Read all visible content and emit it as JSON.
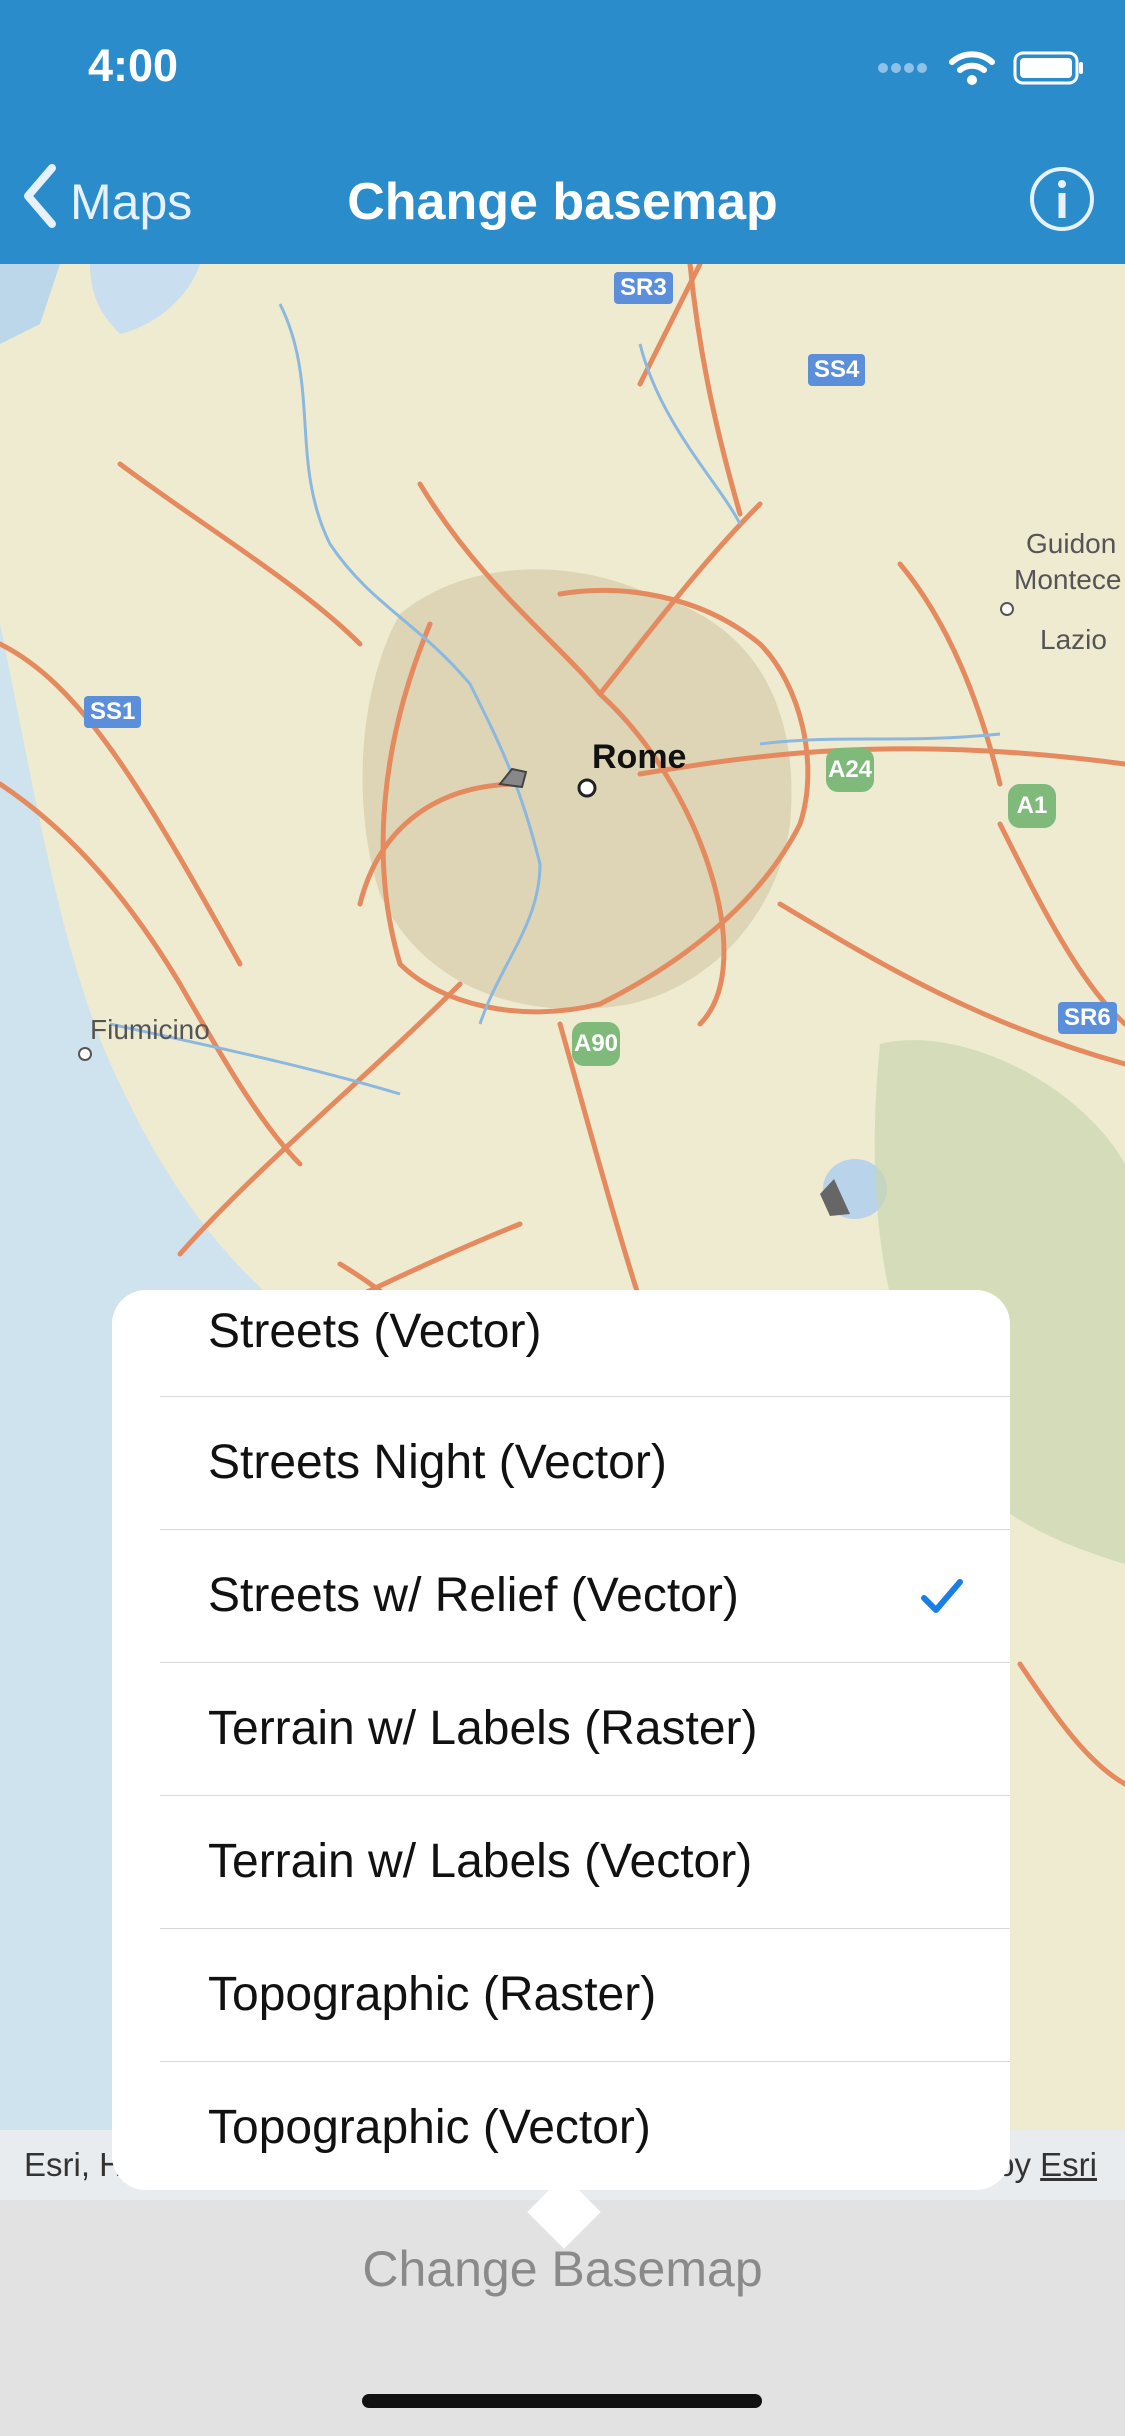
{
  "status_bar": {
    "time": "4:00",
    "colors": {
      "background": "#2a8ccb"
    }
  },
  "nav": {
    "back_label": "Maps",
    "title": "Change basemap"
  },
  "map": {
    "labels": {
      "rome": "Rome",
      "fiumicino": "Fiumicino",
      "guidonia": "Guidon",
      "montecelio": "Montece",
      "lazio": "Lazio"
    },
    "shields": {
      "sr3": "SR3",
      "ss4": "SS4",
      "ss1": "SS1",
      "sr6": "SR6"
    },
    "highways": {
      "a24": "A24",
      "a1": "A1",
      "a90": "A90"
    },
    "attribution_left": "Esri, H",
    "attribution_right_prefix": "by",
    "attribution_link": "Esri"
  },
  "basemap_options": [
    {
      "label": "Streets (Vector)",
      "selected": false
    },
    {
      "label": "Streets Night (Vector)",
      "selected": false
    },
    {
      "label": "Streets w/ Relief (Vector)",
      "selected": true
    },
    {
      "label": "Terrain w/ Labels (Raster)",
      "selected": false
    },
    {
      "label": "Terrain w/ Labels (Vector)",
      "selected": false
    },
    {
      "label": "Topographic (Raster)",
      "selected": false
    },
    {
      "label": "Topographic (Vector)",
      "selected": false
    }
  ],
  "toolbar": {
    "button_label": "Change Basemap"
  },
  "colors": {
    "accent": "#1a7ee6",
    "nav_bar": "#2a8ccb",
    "road": "#e58a5f"
  }
}
